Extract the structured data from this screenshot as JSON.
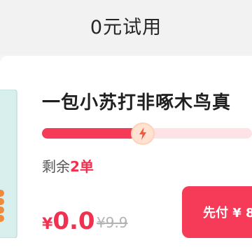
{
  "header": {
    "title": "0元试用"
  },
  "product": {
    "title": "一包小苏打非啄木鸟真",
    "progress_percent": 48,
    "remaining_label": "剩余",
    "remaining_count": "2单",
    "price_symbol": "¥",
    "price_value": "0.0",
    "original_price": "¥9.9",
    "buy_button_label": "先付 ¥ 8"
  },
  "colors": {
    "accent": "#f53b57",
    "progress_track": "#fde3e6",
    "product_package": "#d8efee"
  },
  "icons": {
    "progress_marker": "lightning-bolt-icon"
  }
}
